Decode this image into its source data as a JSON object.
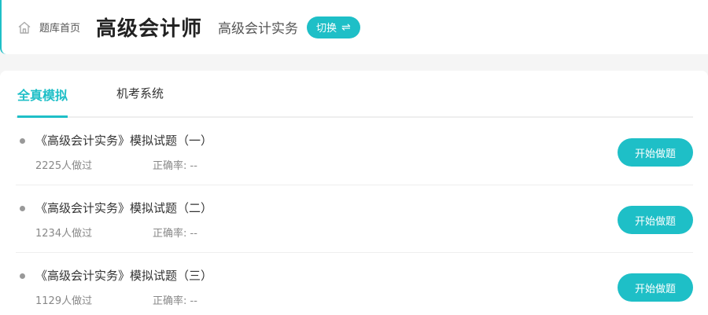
{
  "header": {
    "home_label": "题库首页",
    "title": "高级会计师",
    "subject": "高级会计实务",
    "switch_label": "切换",
    "switch_icon": "⇌"
  },
  "tabs": [
    {
      "label": "全真模拟",
      "active": true
    },
    {
      "label": "机考系统",
      "active": false
    }
  ],
  "exams": [
    {
      "title": "《高级会计实务》模拟试题（一）",
      "done": "2225人做过",
      "accuracy": "正确率: --",
      "button": "开始做题"
    },
    {
      "title": "《高级会计实务》模拟试题（二）",
      "done": "1234人做过",
      "accuracy": "正确率: --",
      "button": "开始做题"
    },
    {
      "title": "《高级会计实务》模拟试题（三）",
      "done": "1129人做过",
      "accuracy": "正确率: --",
      "button": "开始做题"
    }
  ],
  "colors": {
    "accent": "#1ebfc7",
    "background": "#f5f5f5"
  }
}
